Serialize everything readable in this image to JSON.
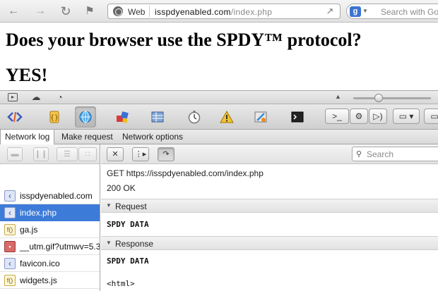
{
  "browser": {
    "url_scheme_label": "Web",
    "url_host": "isspdyenabled.com",
    "url_path": "/index.php",
    "search_engine_badge": "g",
    "search_placeholder": "Search with Google"
  },
  "page": {
    "headline": "Does your browser use the SPDY™ protocol?",
    "answer": "YES!"
  },
  "inspector": {
    "tabs": [
      {
        "label": "Network log",
        "active": true
      },
      {
        "label": "Make request",
        "active": false
      },
      {
        "label": "Network options",
        "active": false
      }
    ],
    "files": [
      {
        "name": "isspdyenabled.com",
        "type": "html",
        "icon_glyph": "‹"
      },
      {
        "name": "index.php",
        "type": "html",
        "icon_glyph": "‹",
        "selected": true
      },
      {
        "name": "ga.js",
        "type": "js",
        "icon_glyph": "f()"
      },
      {
        "name": "__utm.gif?utmwv=5.3",
        "type": "img",
        "icon_glyph": "▪"
      },
      {
        "name": "favicon.ico",
        "type": "html",
        "icon_glyph": "‹"
      },
      {
        "name": "widgets.js",
        "type": "js",
        "icon_glyph": "f()"
      }
    ],
    "search_placeholder": "Search",
    "detail": {
      "request_line": "GET https://isspdyenabled.com/index.php",
      "status_line": "200 OK",
      "request_section": "Request",
      "request_body": "SPDY DATA",
      "response_section": "Response",
      "response_body": "SPDY DATA",
      "response_html": "<html>"
    }
  }
}
